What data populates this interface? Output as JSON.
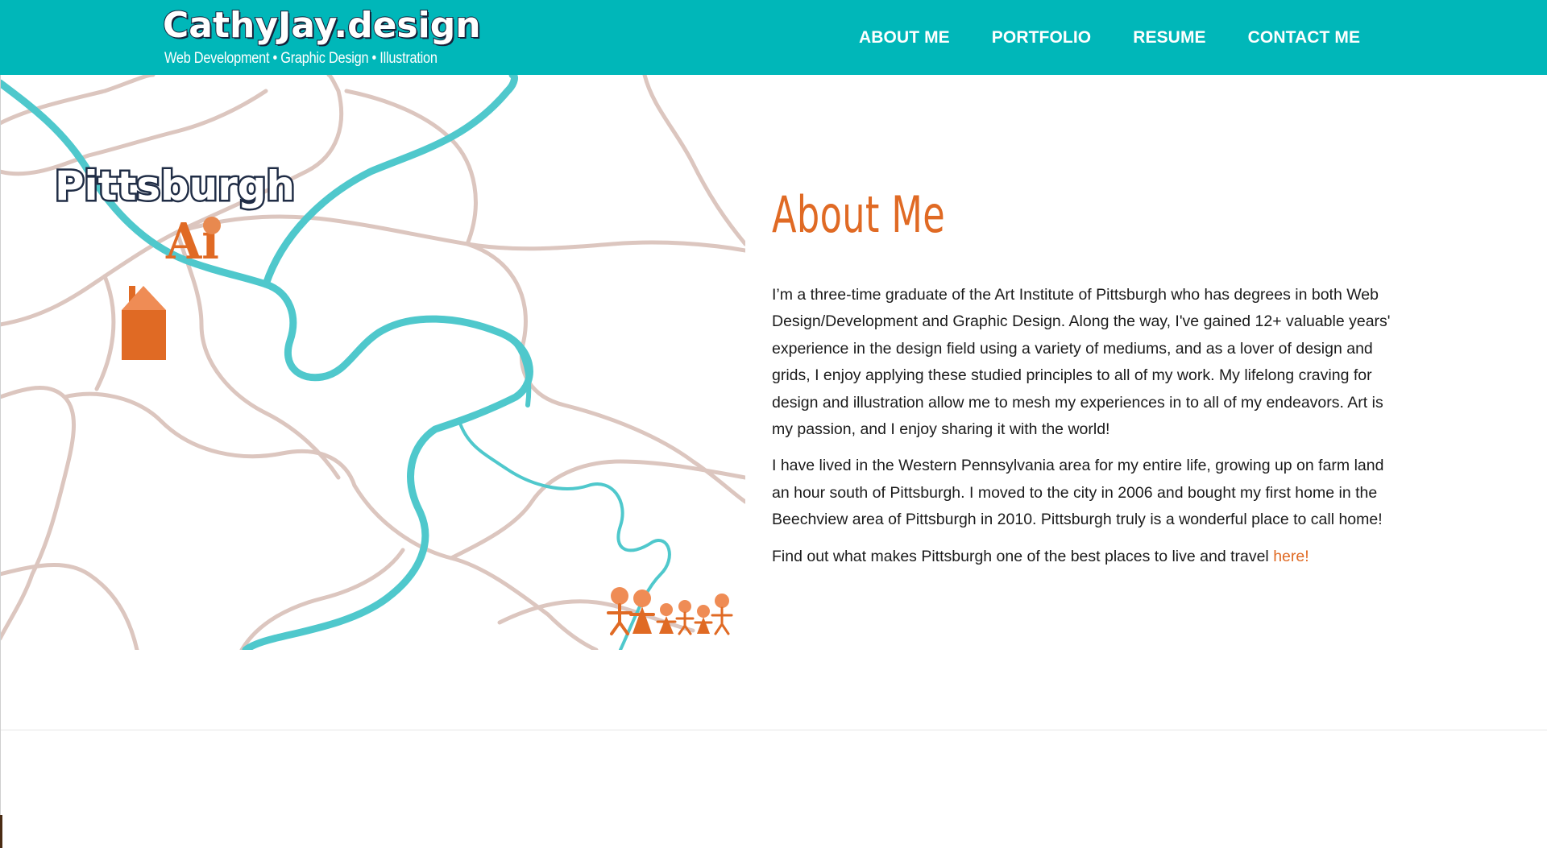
{
  "header": {
    "logo_title": "CathyJay.design",
    "logo_tagline": "Web Development • Graphic Design • Illustration",
    "nav": [
      {
        "label": "ABOUT ME"
      },
      {
        "label": "PORTFOLIO"
      },
      {
        "label": "RESUME"
      },
      {
        "label": "CONTACT ME"
      }
    ]
  },
  "map": {
    "city_label": "Pittsburgh",
    "school_mark": "Ai",
    "icons": [
      "house-icon",
      "family-figures-icon",
      "river",
      "roads"
    ]
  },
  "about": {
    "heading": "About Me",
    "paragraphs": [
      "I’m a three-time graduate of the Art Institute of Pittsburgh who has degrees in both Web Design/Development and Graphic Design. Along the way, I've gained 12+ valuable years' experience in the design field using a variety of mediums, and as a lover of design and grids, I enjoy applying these studied principles to all of my work. My lifelong craving for design and illustration allow me to mesh my experiences in to all of my endeavors. Art is my passion, and I enjoy sharing it with the world!",
      "I have lived in the Western Pennsylvania area for my entire life, growing up on farm land an hour south of Pittsburgh. I moved to the city in 2006 and bought my first home in the Beechview area of Pittsburgh in 2010. Pittsburgh truly is a wonderful place to call home!"
    ],
    "closing_text": "Find out what makes Pittsburgh one of the best places to live and travel ",
    "closing_link": "here!"
  },
  "colors": {
    "header_bg": "#00b7b9",
    "accent_orange": "#e06a24",
    "river": "#4fc8cc",
    "road": "#dcc6bf"
  }
}
